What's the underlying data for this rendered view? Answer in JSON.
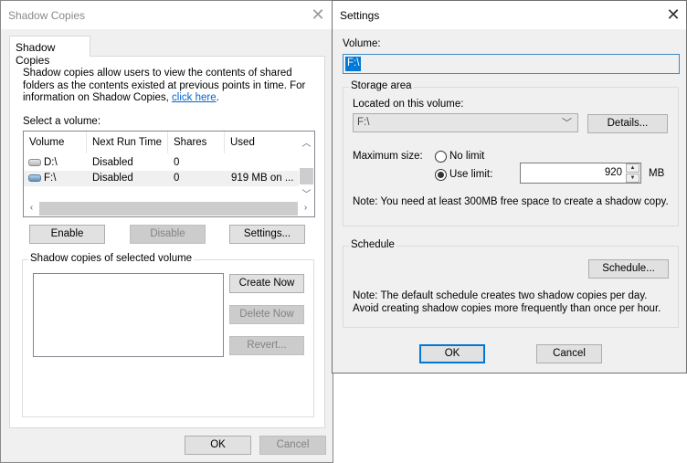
{
  "shadow_copies_dialog": {
    "title": "Shadow Copies",
    "close_icon": "close-icon",
    "tab_label": "Shadow Copies",
    "description_text": "Shadow copies allow users to view the contents of shared folders as the contents existed at previous points in time. For information on Shadow Copies, ",
    "description_link": "click here",
    "description_end": ".",
    "select_volume_label": "Select a volume:",
    "volume_list": {
      "columns": [
        "Volume",
        "Next Run Time",
        "Shares",
        "Used"
      ],
      "rows": [
        {
          "icon": "drive-icon",
          "volume": "D:\\",
          "next_run_time": "Disabled",
          "shares": "0",
          "used": "",
          "selected": false
        },
        {
          "icon": "drive-icon",
          "volume": "F:\\",
          "next_run_time": "Disabled",
          "shares": "0",
          "used": "919 MB on ...",
          "selected": true
        }
      ]
    },
    "buttons": {
      "enable": "Enable",
      "disable": "Disable",
      "settings": "Settings..."
    },
    "snapshot_group": {
      "title": "Shadow copies of selected volume",
      "create_now": "Create Now",
      "delete_now": "Delete Now",
      "revert": "Revert..."
    },
    "footer": {
      "ok": "OK",
      "cancel": "Cancel"
    }
  },
  "settings_dialog": {
    "title": "Settings",
    "close_icon": "close-icon",
    "volume_label": "Volume:",
    "volume_value": "F:\\",
    "storage_area": {
      "title": "Storage area",
      "located_label": "Located on this volume:",
      "located_value": "F:\\",
      "details_button": "Details...",
      "max_size_label": "Maximum size:",
      "no_limit_label": "No limit",
      "use_limit_label": "Use limit:",
      "selected_option": "Use limit",
      "limit_value": "920",
      "limit_unit": "MB",
      "note": "Note: You need at least 300MB free space to create a shadow copy."
    },
    "schedule": {
      "title": "Schedule",
      "schedule_button": "Schedule...",
      "note": "Note: The default schedule creates two shadow copies per day. Avoid creating shadow copies more frequently than once per hour."
    },
    "footer": {
      "ok": "OK",
      "cancel": "Cancel"
    }
  }
}
